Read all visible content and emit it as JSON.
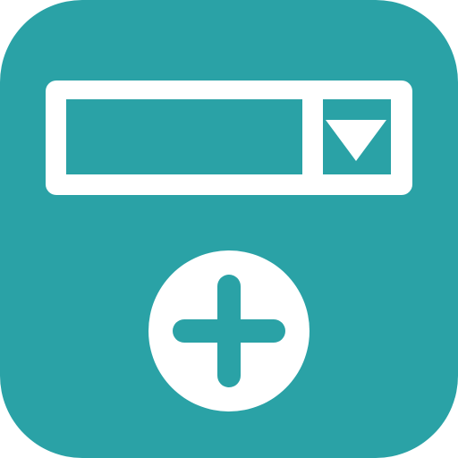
{
  "icon": {
    "name": "add-dropdown-app-icon",
    "colors": {
      "background": "#2aa2a6",
      "foreground": "#ffffff",
      "plus": "#2aa2a6"
    },
    "elements": [
      "dropdown-field-icon",
      "dropdown-arrow-icon",
      "add-circle-icon",
      "plus-icon"
    ]
  }
}
